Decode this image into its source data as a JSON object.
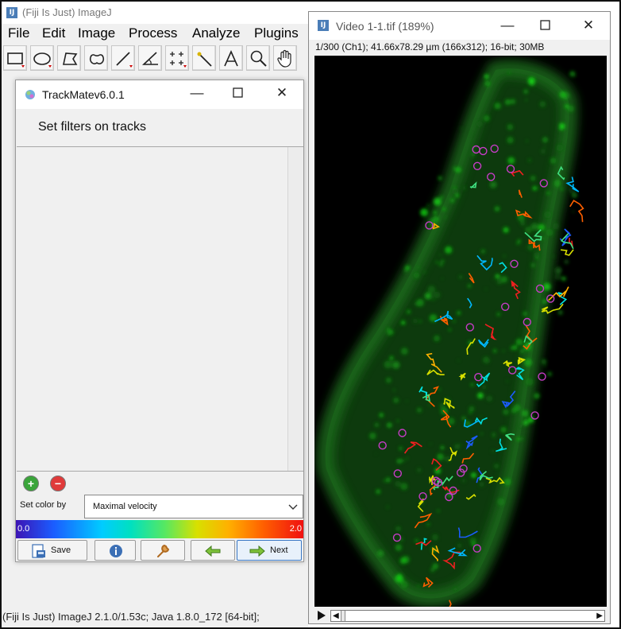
{
  "imagej": {
    "title": "(Fiji Is Just) ImageJ",
    "app_icon": "IJ",
    "menu": [
      "File",
      "Edit",
      "Image",
      "Process",
      "Analyze",
      "Plugins"
    ],
    "tools": [
      "rectangle-tool-icon",
      "oval-tool-icon",
      "polygon-tool-icon",
      "freehand-tool-icon",
      "line-tool-icon",
      "angle-tool-icon",
      "point-tool-icon",
      "wand-tool-icon",
      "text-tool-icon",
      "magnifier-tool-icon",
      "hand-tool-icon"
    ],
    "status": "(Fiji Is Just) ImageJ 2.1.0/1.53c; Java 1.8.0_172 [64-bit];"
  },
  "trackmate": {
    "title": "TrackMatev6.0.1",
    "heading": "Set filters on tracks",
    "add_symbol": "+",
    "remove_symbol": "−",
    "color_by_label": "Set color by",
    "color_by_value": "Maximal velocity",
    "gradient_min": "0.0",
    "gradient_max": "2.0",
    "buttons": {
      "save": "Save",
      "next": "Next"
    }
  },
  "video": {
    "title": "Video 1-1.tif (189%)",
    "app_icon": "IJ",
    "info": "1/300 (Ch1); 41.66x78.29 µm (166x312); 16-bit; 30MB",
    "frame_position": 0.0
  },
  "window_controls": {
    "minimize": "—",
    "close": "✕"
  },
  "colors": {
    "trackmate_icon": "#6fb0e0",
    "add_button": "#3aa53a",
    "remove_button": "#e03a3a",
    "tissue_green": "#1f6e1f",
    "spot_magenta": "#c63cc6"
  }
}
